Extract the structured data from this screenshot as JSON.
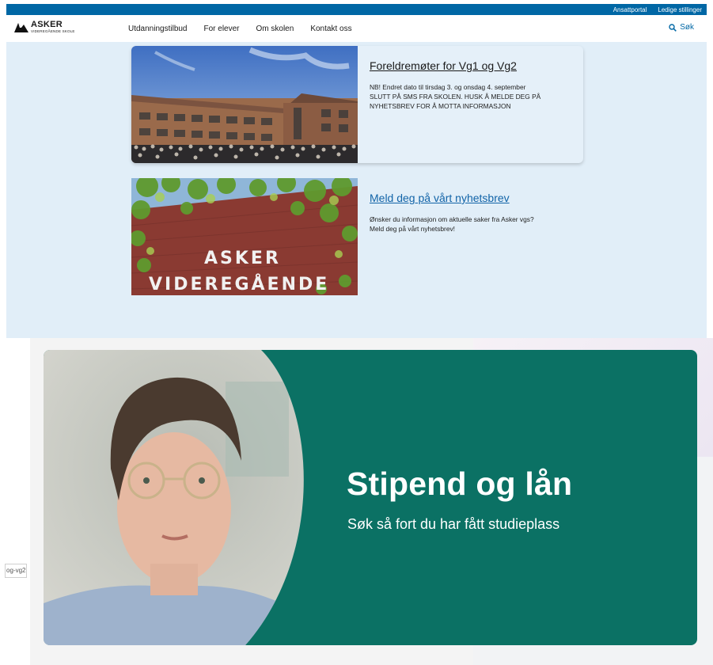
{
  "topbar": {
    "links": [
      "Ansattportal",
      "Ledige stillinger"
    ]
  },
  "header": {
    "logo": {
      "name": "ASKER",
      "sub": "VIDEREGÅENDE SKOLE"
    },
    "nav": [
      "Utdanningstilbud",
      "For elever",
      "Om skolen",
      "Kontakt oss"
    ],
    "search_label": "Søk"
  },
  "cards": [
    {
      "title": "Foreldremøter for Vg1 og Vg2",
      "lines": [
        "NB! Endret dato til tirsdag 3. og onsdag 4. september",
        "SLUTT PÅ SMS FRA SKOLEN. HUSK Å MELDE DEG PÅ",
        "NYHETSBREV FOR Å MOTTA INFORMASJON"
      ]
    },
    {
      "title": "Meld deg på vårt nyhetsbrev",
      "lines": [
        "Ønsker du informasjon om aktuelle saker fra Asker vgs?",
        "Meld deg på vårt nyhetsbrev!"
      ],
      "sign": [
        "ASKER",
        "VIDEREGÅENDE"
      ]
    }
  ],
  "promo": {
    "title": "Stipend og lån",
    "subtitle": "Søk så fort du har fått studieplass"
  },
  "status_url": "og-vg2.",
  "colors": {
    "topbar": "#0067a5",
    "link": "#1264a8",
    "promo": "#0b7164",
    "background": "#e1eef8"
  }
}
